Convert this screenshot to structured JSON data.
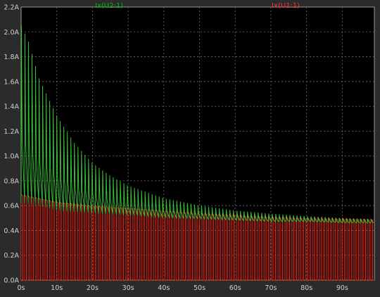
{
  "chart_data": {
    "type": "line",
    "title": "",
    "xlabel": "",
    "ylabel": "",
    "xlim": [
      0,
      99
    ],
    "ylim": [
      0,
      2.2
    ],
    "grid": true,
    "legend_placement": "top",
    "x_tick_labels": [
      "0s",
      "10s",
      "20s",
      "30s",
      "40s",
      "50s",
      "60s",
      "70s",
      "80s",
      "90s"
    ],
    "x_ticks": [
      0,
      10,
      20,
      30,
      40,
      50,
      60,
      70,
      80,
      90
    ],
    "y_tick_labels": [
      "0.0A",
      "0.2A",
      "0.4A",
      "0.6A",
      "0.8A",
      "1.0A",
      "1.2A",
      "1.4A",
      "1.6A",
      "1.8A",
      "2.0A",
      "2.2A"
    ],
    "y_ticks": [
      0,
      0.2,
      0.4,
      0.6,
      0.8,
      1.0,
      1.2,
      1.4,
      1.6,
      1.8,
      2.0,
      2.2
    ],
    "pulse_count": 100,
    "series": [
      {
        "name": "Ix(U2:1)",
        "color": "#3ddc3d",
        "label_color": "#00c000",
        "description": "pulse peaks decaying from ~2.05A to ~0.49A",
        "peak_envelope": {
          "x": [
            0,
            2,
            5,
            10,
            15,
            20,
            25,
            30,
            40,
            50,
            60,
            70,
            80,
            90,
            99
          ],
          "y": [
            2.05,
            1.92,
            1.62,
            1.32,
            1.1,
            0.94,
            0.84,
            0.76,
            0.66,
            0.6,
            0.56,
            0.535,
            0.515,
            0.5,
            0.49
          ]
        },
        "trough_envelope": {
          "x": [
            0,
            5,
            10,
            15,
            20,
            25,
            30,
            40,
            50,
            60,
            70,
            80,
            90,
            99
          ],
          "y": [
            0.62,
            0.6,
            0.56,
            0.55,
            0.54,
            0.53,
            0.52,
            0.5,
            0.49,
            0.48,
            0.47,
            0.47,
            0.46,
            0.46
          ]
        }
      },
      {
        "name": "Ix(U1:1)",
        "color": "#ff2a1a",
        "label_color": "#ff3030",
        "description": "square pulses 0A to ~0.69A decaying to ~0.49A",
        "peak_envelope": {
          "x": [
            0,
            5,
            10,
            20,
            30,
            40,
            50,
            60,
            70,
            80,
            90,
            99
          ],
          "y": [
            0.69,
            0.66,
            0.63,
            0.6,
            0.58,
            0.56,
            0.54,
            0.525,
            0.51,
            0.5,
            0.495,
            0.49
          ]
        },
        "trough_envelope": {
          "x": [
            0,
            99
          ],
          "y": [
            0,
            0
          ]
        }
      }
    ]
  }
}
